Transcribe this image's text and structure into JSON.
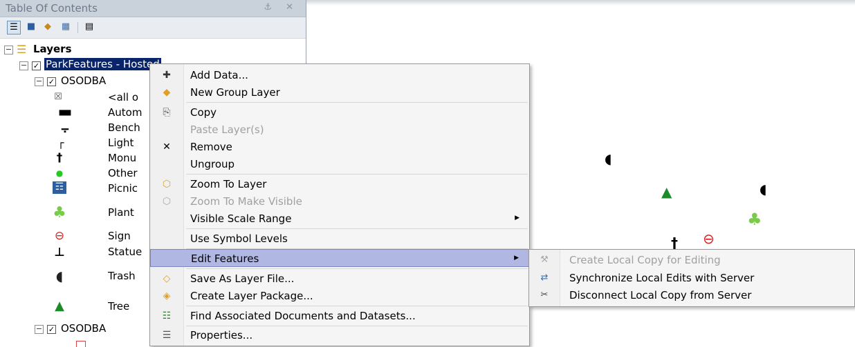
{
  "toc": {
    "title": "Table Of Contents",
    "title_buttons": "⚓ ✕",
    "toolbar_icons": [
      "list-by-drawing-order-icon",
      "list-by-source-icon",
      "list-by-visibility-icon",
      "list-by-selection-icon",
      "options-icon"
    ],
    "root": {
      "label": "Layers",
      "expanded": true
    },
    "layer": {
      "label": "ParkFeatures - Hosted",
      "checked": true,
      "expanded": true,
      "selected": true
    },
    "sublayer1": {
      "label": "OSODBA",
      "checked": true
    },
    "legend": [
      {
        "label": "<all o",
        "icon": "all-other-values-icon",
        "glyph": "☒"
      },
      {
        "label": "Autom",
        "icon": "automobile-icon",
        "glyph": "▬"
      },
      {
        "label": "Bench",
        "icon": "bench-icon",
        "glyph": "⨪"
      },
      {
        "label": "Light",
        "icon": "light-icon",
        "glyph": "┌"
      },
      {
        "label": "Monu",
        "icon": "monument-icon",
        "glyph": "†"
      },
      {
        "label": "Other",
        "icon": "other-dot-icon",
        "glyph": "●"
      },
      {
        "label": "Picnic",
        "icon": "picnic-table-icon",
        "glyph": "☶"
      },
      {
        "label": "Plant",
        "icon": "plant-icon",
        "glyph": "♣"
      },
      {
        "label": "Sign",
        "icon": "sign-icon",
        "glyph": "⊖"
      },
      {
        "label": "Statue",
        "icon": "statue-icon",
        "glyph": "⊥"
      },
      {
        "label": "Trash",
        "icon": "trash-icon",
        "glyph": "◖"
      },
      {
        "label": "Tree",
        "icon": "tree-icon",
        "glyph": "▲"
      }
    ],
    "sublayer2": {
      "label": "OSODBA",
      "checked": true
    }
  },
  "context_menu": {
    "items": [
      {
        "label": "Add Data...",
        "icon": "add-data-icon",
        "glyph": "✚",
        "enabled": true
      },
      {
        "label": "New Group Layer",
        "icon": "new-group-layer-icon",
        "glyph": "◆",
        "enabled": true
      },
      {
        "label": "Copy",
        "icon": "copy-icon",
        "glyph": "⎘",
        "enabled": true
      },
      {
        "label": "Paste Layer(s)",
        "icon": "",
        "glyph": "",
        "enabled": false
      },
      {
        "label": "Remove",
        "icon": "remove-icon",
        "glyph": "✕",
        "enabled": true
      },
      {
        "label": "Ungroup",
        "icon": "",
        "glyph": "",
        "enabled": true
      },
      {
        "label": "Zoom To Layer",
        "icon": "zoom-to-layer-icon",
        "glyph": "⬡",
        "enabled": true
      },
      {
        "label": "Zoom To Make Visible",
        "icon": "zoom-to-make-visible-icon",
        "glyph": "⬡",
        "enabled": false
      },
      {
        "label": "Visible Scale Range",
        "icon": "",
        "glyph": "",
        "enabled": true,
        "submenu": true
      },
      {
        "label": "Use Symbol Levels",
        "icon": "",
        "glyph": "",
        "enabled": true
      },
      {
        "label": "Edit Features",
        "icon": "",
        "glyph": "",
        "enabled": true,
        "submenu": true,
        "highlighted": true
      },
      {
        "label": "Save As Layer File...",
        "icon": "save-layer-file-icon",
        "glyph": "◇",
        "enabled": true
      },
      {
        "label": "Create Layer Package...",
        "icon": "layer-package-icon",
        "glyph": "◈",
        "enabled": true
      },
      {
        "label": "Find Associated Documents and Datasets...",
        "icon": "find-documents-icon",
        "glyph": "☷",
        "enabled": true
      },
      {
        "label": "Properties...",
        "icon": "properties-icon",
        "glyph": "☰",
        "enabled": true
      }
    ]
  },
  "submenu": {
    "items": [
      {
        "label": "Create Local Copy for Editing",
        "icon": "create-local-copy-icon",
        "glyph": "⚒",
        "enabled": false
      },
      {
        "label": "Synchronize Local Edits with Server",
        "icon": "synchronize-icon",
        "glyph": "⇄",
        "enabled": true
      },
      {
        "label": "Disconnect Local Copy from Server",
        "icon": "disconnect-icon",
        "glyph": "✂",
        "enabled": true
      }
    ]
  },
  "map_symbols": [
    {
      "name": "trash-map-icon",
      "glyph": "◖",
      "color": "#2a2a2a"
    },
    {
      "name": "tree-map-icon",
      "glyph": "▲",
      "color": "#1f8a2a"
    },
    {
      "name": "trash-map-icon-2",
      "glyph": "◖",
      "color": "#2a2a2a"
    },
    {
      "name": "plant-map-icon",
      "glyph": "♣",
      "color": "#7acb4a"
    },
    {
      "name": "monument-map-icon",
      "glyph": "†",
      "color": "#000000"
    },
    {
      "name": "sign-map-icon",
      "glyph": "⊖",
      "color": "#d42020"
    }
  ],
  "colors": {
    "selection": "#0a246a",
    "menu_highlight": "#b0b7e2",
    "toc_title_bg": "#c9d1db"
  }
}
